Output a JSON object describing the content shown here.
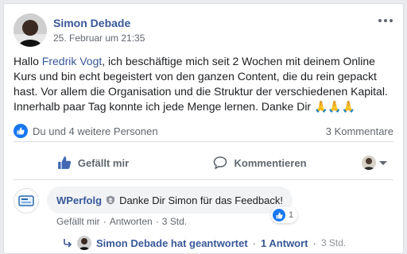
{
  "post": {
    "author": "Simon Debade",
    "timestamp": "25. Februar um 21:35",
    "text_before": "Hallo ",
    "mention": "Fredrik Vogt",
    "text_after": ", ich beschäftige mich seit 2 Wochen mit deinem Online Kurs und bin echt begeistert von den ganzen Content, die du rein gepackt hast. Vor allem die Organisation und die Struktur der verschiedenen Kapital. Innerhalb paar Tag konnte ich jede Menge lernen. Danke Dir 🙏🙏🙏"
  },
  "stats": {
    "likes_text": "Du und 4 weitere Personen",
    "comments_text": "3 Kommentare"
  },
  "actions": {
    "like_label": "Gefällt mir",
    "comment_label": "Kommentieren"
  },
  "comment": {
    "author": "WPerfolg",
    "text": "Danke Dir Simon für das Feedback!",
    "like_action": "Gefällt mir",
    "reply_action": "Antworten",
    "time": "3 Std.",
    "reaction_count": "1",
    "separator": "·"
  },
  "replies": {
    "author_summary": "Simon Debade hat geantwortet",
    "count": "1 Antwort",
    "time": "3 Std.",
    "separator": "·"
  },
  "colors": {
    "link": "#385898",
    "accent": "#1877f2",
    "muted": "#606770"
  }
}
